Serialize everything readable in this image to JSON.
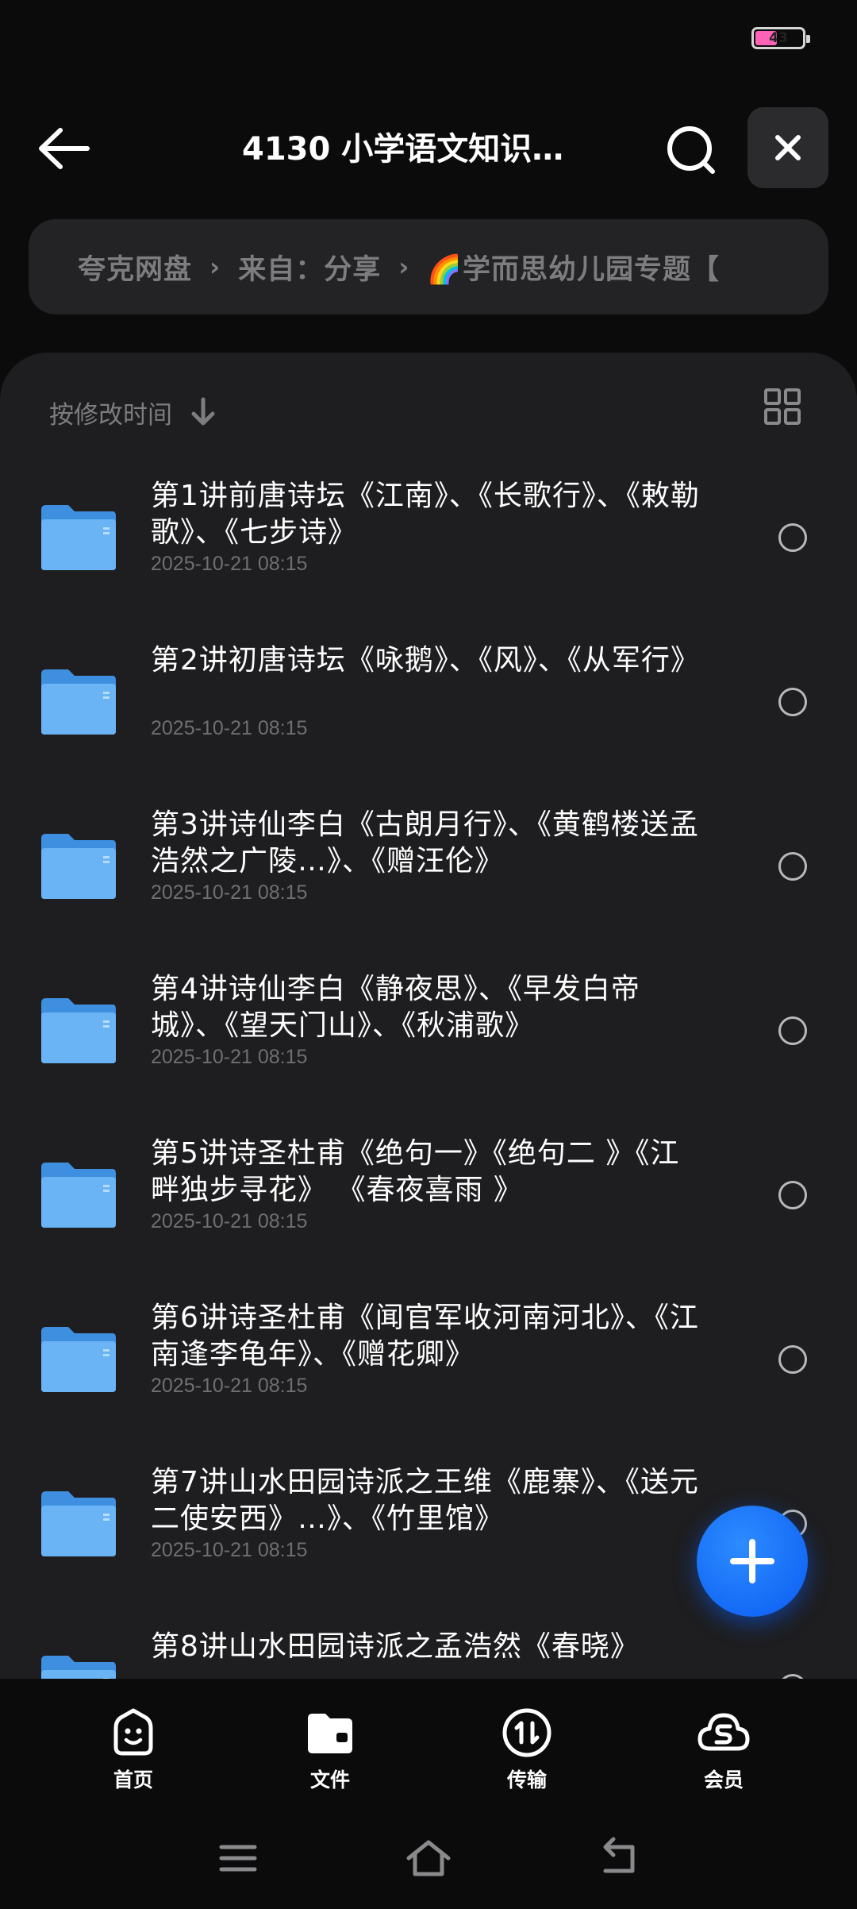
{
  "status": {
    "battery": "43",
    "battery_color": "#ff63b8"
  },
  "header": {
    "title": "4130 小学语文知识…"
  },
  "breadcrumb": {
    "items": [
      "夸克网盘",
      "来自：分享",
      "🌈学而思幼儿园专题【"
    ],
    "separator": "›"
  },
  "sort": {
    "label": "按修改时间"
  },
  "files": [
    {
      "name": "第1讲前唐诗坛《江南》、《长歌行》、《敕勒歌》、《七步诗》",
      "date": "2025-10-21 08:15"
    },
    {
      "name": "第2讲初唐诗坛《咏鹅》、《风》、《从军行》",
      "date": "2025-10-21 08:15"
    },
    {
      "name": "第3讲诗仙李白《古朗月行》、《黄鹤楼送孟浩然之广陵…》、《赠汪伦》",
      "date": "2025-10-21 08:15"
    },
    {
      "name": "第4讲诗仙李白《静夜思》、《早发白帝城》、《望天门山》、《秋浦歌》",
      "date": "2025-10-21 08:15"
    },
    {
      "name": "第5讲诗圣杜甫《绝句一》《绝句二 》《江畔独步寻花》 《春夜喜雨 》",
      "date": "2025-10-21 08:15"
    },
    {
      "name": "第6讲诗圣杜甫《闻官军收河南河北》、《江南逢李龟年》、《赠花卿》",
      "date": "2025-10-21 08:15"
    },
    {
      "name": "第7讲山水田园诗派之王维《鹿寨》、《送元二使安西》…》、《竹里馆》",
      "date": "2025-10-21 08:15"
    },
    {
      "name": "第8讲山水田园诗派之孟浩然《春晓》",
      "date": ""
    }
  ],
  "nav": [
    {
      "label": "首页",
      "icon": "home-face-icon"
    },
    {
      "label": "文件",
      "icon": "folder-icon"
    },
    {
      "label": "传输",
      "icon": "transfer-icon"
    },
    {
      "label": "会员",
      "icon": "member-cloud-icon"
    }
  ],
  "colors": {
    "accent": "#0a5cf2",
    "folder": "#5aa9f0"
  }
}
